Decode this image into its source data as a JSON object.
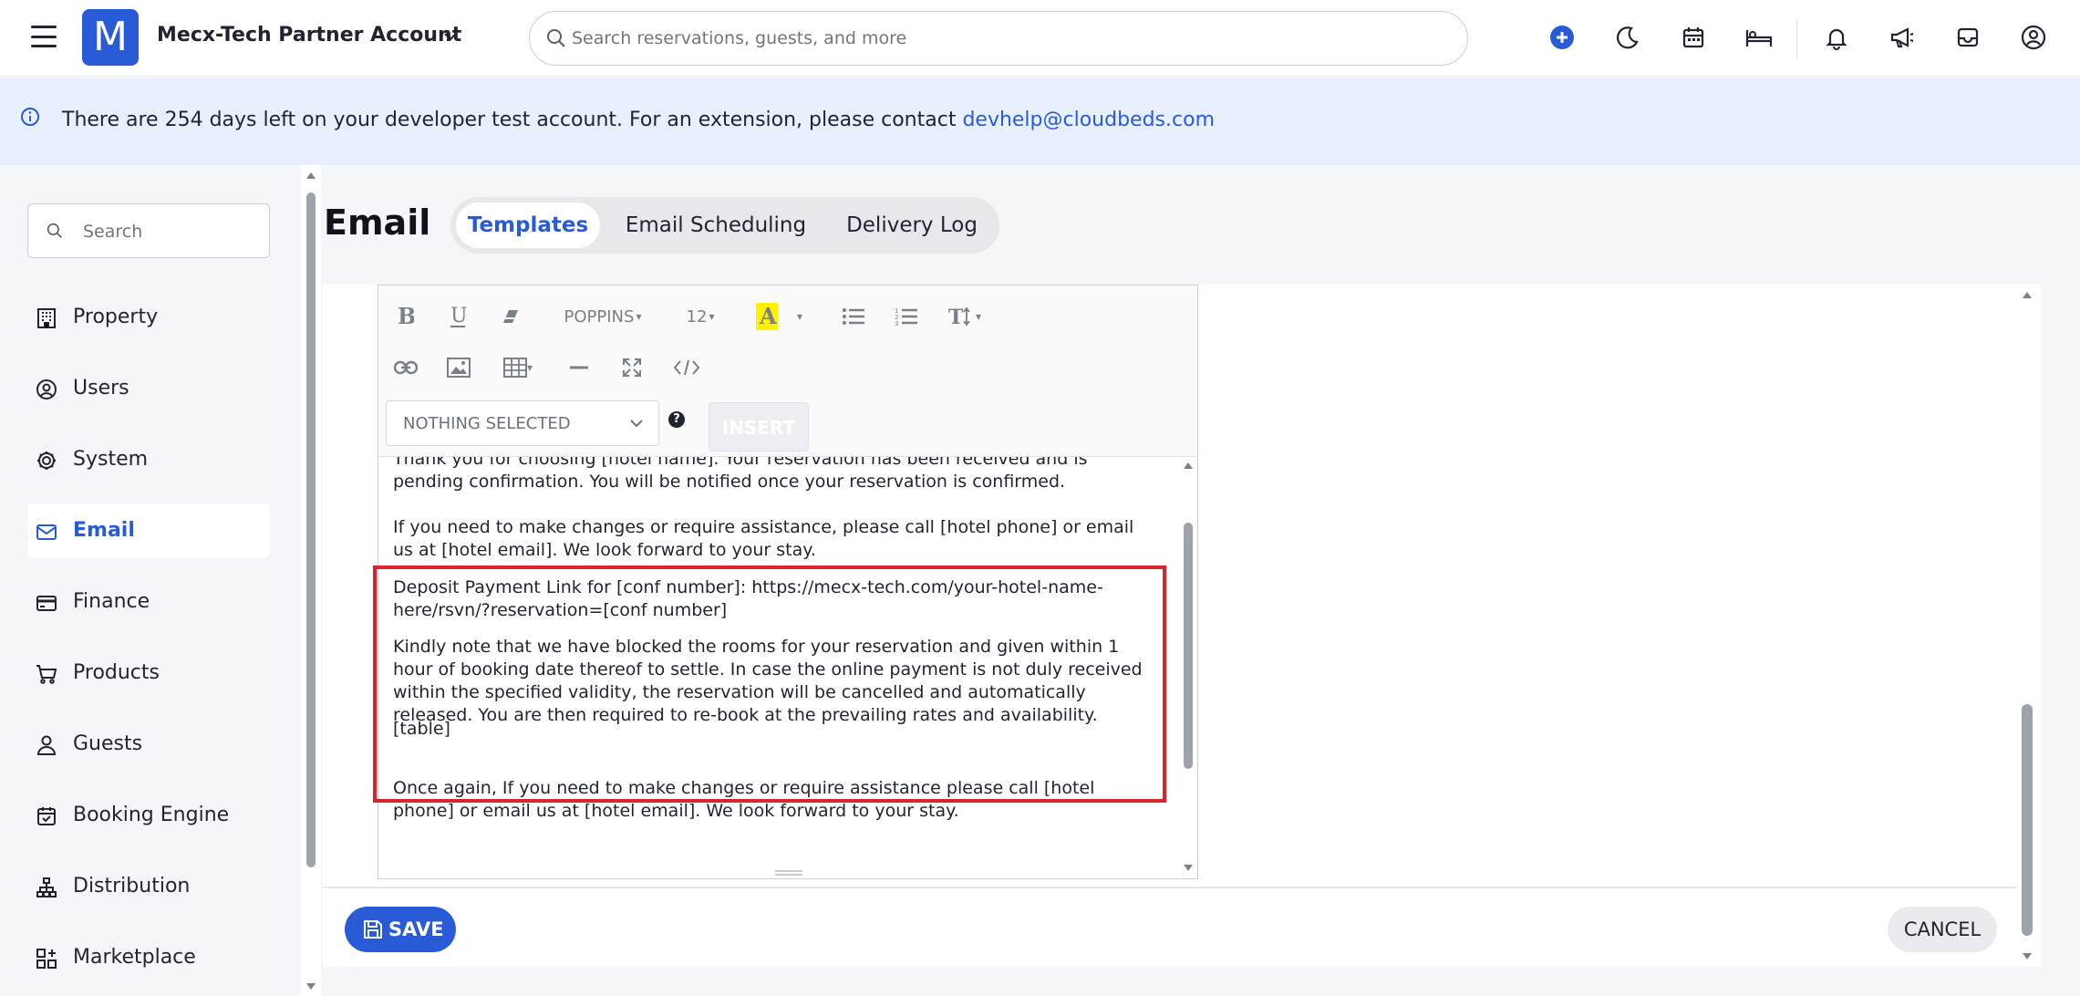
{
  "header": {
    "account_name": "Mecx-Tech Partner Account",
    "logo_letter": "M",
    "search_placeholder": "Search reservations, guests, and more",
    "brand_color": "#2a5bd7"
  },
  "banner": {
    "message": "There are 254 days left on your developer test account. For an extension, please contact ",
    "email": "devhelp@cloudbeds.com"
  },
  "sidebar": {
    "search_placeholder": "Search",
    "items": [
      {
        "label": "Property",
        "icon": "building-icon"
      },
      {
        "label": "Users",
        "icon": "user-circle-icon"
      },
      {
        "label": "System",
        "icon": "gear-icon"
      },
      {
        "label": "Email",
        "icon": "envelope-icon",
        "active": true
      },
      {
        "label": "Finance",
        "icon": "credit-card-icon"
      },
      {
        "label": "Products",
        "icon": "cart-icon"
      },
      {
        "label": "Guests",
        "icon": "person-icon"
      },
      {
        "label": "Booking Engine",
        "icon": "calendar-check-icon"
      },
      {
        "label": "Distribution",
        "icon": "hierarchy-icon"
      },
      {
        "label": "Marketplace",
        "icon": "grid-plus-icon"
      }
    ]
  },
  "page": {
    "title": "Email",
    "tabs": [
      {
        "label": "Templates",
        "active": true
      },
      {
        "label": "Email Scheduling"
      },
      {
        "label": "Delivery Log"
      }
    ]
  },
  "editor": {
    "font_name": "POPPINS",
    "font_size": "12",
    "variable_select": "NOTHING SELECTED",
    "help": "?",
    "insert_label": "INSERT",
    "paragraphs": {
      "p1": "Thank you for choosing [hotel name]. Your reservation has been received and is pending confirmation. You will be notified once your reservation is confirmed.",
      "p2": "If you need to make changes or require assistance, please call [hotel phone] or email us at [hotel email]. We look forward to your stay.",
      "p3": "Deposit Payment Link for [conf number]: https://mecx-tech.com/your-hotel-name-here/rsvn/?reservation=[conf number]",
      "p4": "Kindly note that we have blocked the rooms for your reservation and given within 1 hour of booking date thereof to settle. In case the online payment is not duly received within the specified validity, the reservation will be cancelled and automatically released. You are then required to re-book at the prevailing rates and availability.",
      "p5": "[table]",
      "p6": "Once again, If you need to make changes or require assistance please call [hotel phone] or email us at [hotel email]. We look forward to your stay."
    }
  },
  "footer": {
    "save_label": "SAVE",
    "cancel_label": "CANCEL"
  }
}
